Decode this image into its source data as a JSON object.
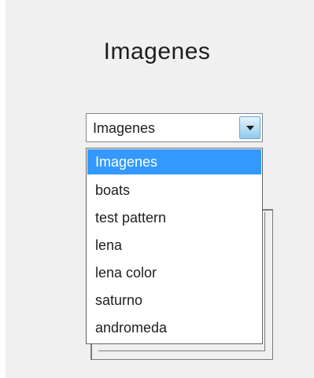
{
  "title": "Imagenes",
  "select": {
    "value": "Imagenes",
    "arrow_icon": "chevron-down-icon"
  },
  "options": [
    {
      "label": "Imagenes",
      "selected": true
    },
    {
      "label": "boats",
      "selected": false
    },
    {
      "label": "test pattern",
      "selected": false
    },
    {
      "label": "lena",
      "selected": false
    },
    {
      "label": "lena color",
      "selected": false
    },
    {
      "label": "saturno",
      "selected": false
    },
    {
      "label": "andromeda",
      "selected": false
    }
  ],
  "colors": {
    "panel_background": "#f0f0f0",
    "highlight": "#3399ff",
    "highlight_text": "#ffffff"
  }
}
